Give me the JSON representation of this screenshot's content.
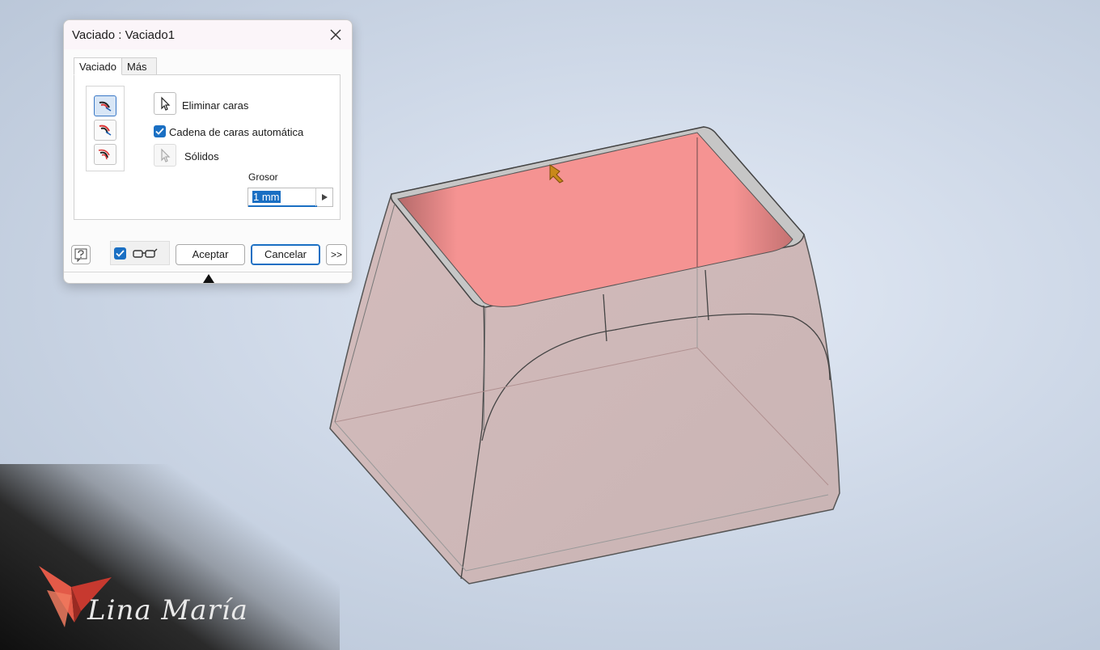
{
  "dialog": {
    "title": "Vaciado : Vaciado1",
    "tabs": [
      {
        "label": "Vaciado",
        "active": true
      },
      {
        "label": "Más",
        "active": false
      }
    ],
    "remove_faces_label": "Eliminar caras",
    "auto_chain_label": "Cadena de caras automática",
    "auto_chain_checked": true,
    "solids_label": "Sólidos",
    "thickness_label": "Grosor",
    "thickness_value": "1 mm",
    "preview_checked": true,
    "ok_label": "Aceptar",
    "cancel_label": "Cancelar",
    "more_label": ">>",
    "direction_modes": [
      "shell-inside-icon",
      "shell-outside-icon",
      "shell-both-icon"
    ]
  },
  "watermark": {
    "text": "Lina María"
  },
  "colors": {
    "accent": "#1a6fc3",
    "selected_face": "#f28f8e",
    "part_body": "#d9c1c0",
    "part_edge": "#333333"
  }
}
